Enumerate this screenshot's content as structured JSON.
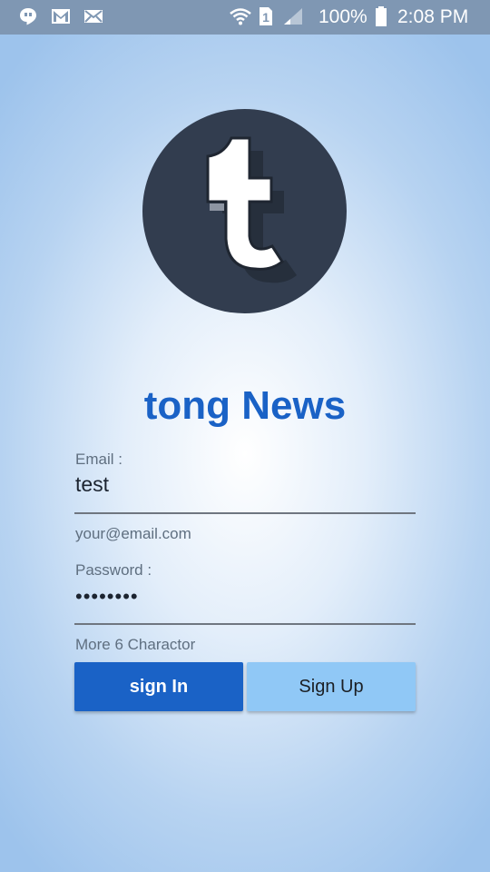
{
  "status_bar": {
    "icons": [
      "hangouts-icon",
      "gmail-icon",
      "email-icon",
      "wifi-icon",
      "sim-1-icon",
      "signal-icon",
      "battery-icon"
    ],
    "battery": "100%",
    "time": "2:08 PM"
  },
  "app": {
    "logo_icon": "tumblr-t-logo",
    "title": "tong News"
  },
  "form": {
    "email_label": "Email :",
    "email_value": "test",
    "email_hint": "your@email.com",
    "password_label": "Password :",
    "password_value": "••••••••",
    "password_hint": "More 6 Charactor"
  },
  "buttons": {
    "sign_in": "sign In",
    "sign_up": "Sign Up"
  },
  "colors": {
    "accent": "#1a62c6",
    "secondary_button": "#90c8f6",
    "logo_bg": "#323d4f",
    "status_bar": "#7f97b3"
  }
}
